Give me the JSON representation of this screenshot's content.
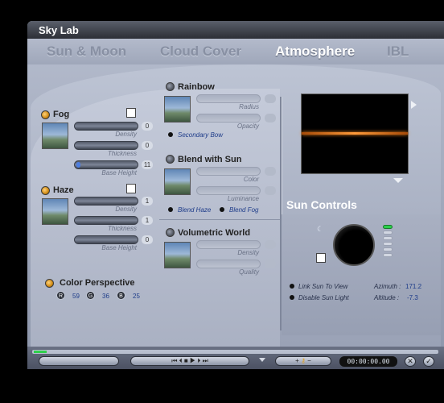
{
  "window": {
    "title": "Sky Lab"
  },
  "tabs": [
    {
      "label": "Sun & Moon"
    },
    {
      "label": "Cloud Cover"
    },
    {
      "label": "Atmosphere"
    },
    {
      "label": "IBL"
    }
  ],
  "fog": {
    "label": "Fog",
    "sliders": [
      {
        "label": "Density",
        "value": "0"
      },
      {
        "label": "Thickness",
        "value": "0"
      },
      {
        "label": "Base Height",
        "value": "11"
      }
    ]
  },
  "haze": {
    "label": "Haze",
    "sliders": [
      {
        "label": "Density",
        "value": "1"
      },
      {
        "label": "Thickness",
        "value": "1"
      },
      {
        "label": "Base Height",
        "value": "0"
      }
    ]
  },
  "color_perspective": {
    "label": "Color Perspective",
    "r_label": "R",
    "r": "59",
    "g_label": "G",
    "g": "36",
    "b_label": "B",
    "b": "25"
  },
  "rainbow": {
    "label": "Rainbow",
    "sliders": [
      {
        "label": "Radius"
      },
      {
        "label": "Opacity"
      }
    ],
    "option": "Secondary Bow"
  },
  "blend_with_sun": {
    "label": "Blend with Sun",
    "sliders": [
      {
        "label": "Color"
      },
      {
        "label": "Luminance"
      }
    ],
    "option_a": "Blend Haze",
    "option_b": "Blend Fog"
  },
  "volumetric_world": {
    "label": "Volumetric World",
    "sliders": [
      {
        "label": "Density"
      },
      {
        "label": "Quality"
      }
    ]
  },
  "sun_controls": {
    "title": "Sun Controls",
    "link_sun": "Link Sun To View",
    "disable_light": "Disable Sun Light",
    "azimuth_label": "Azimuth :",
    "azimuth_value": "171.2",
    "altitude_label": "Altitude :",
    "altitude_value": "-7.3"
  },
  "transport": {
    "plus": "+",
    "minus": "−",
    "timecode": "00:00:00.00",
    "close": "✕",
    "ok": "✓"
  },
  "colors": {
    "accent_orange": "#f0a22a",
    "progress_green": "#2fd04c",
    "link_blue": "#1e3c8a"
  }
}
